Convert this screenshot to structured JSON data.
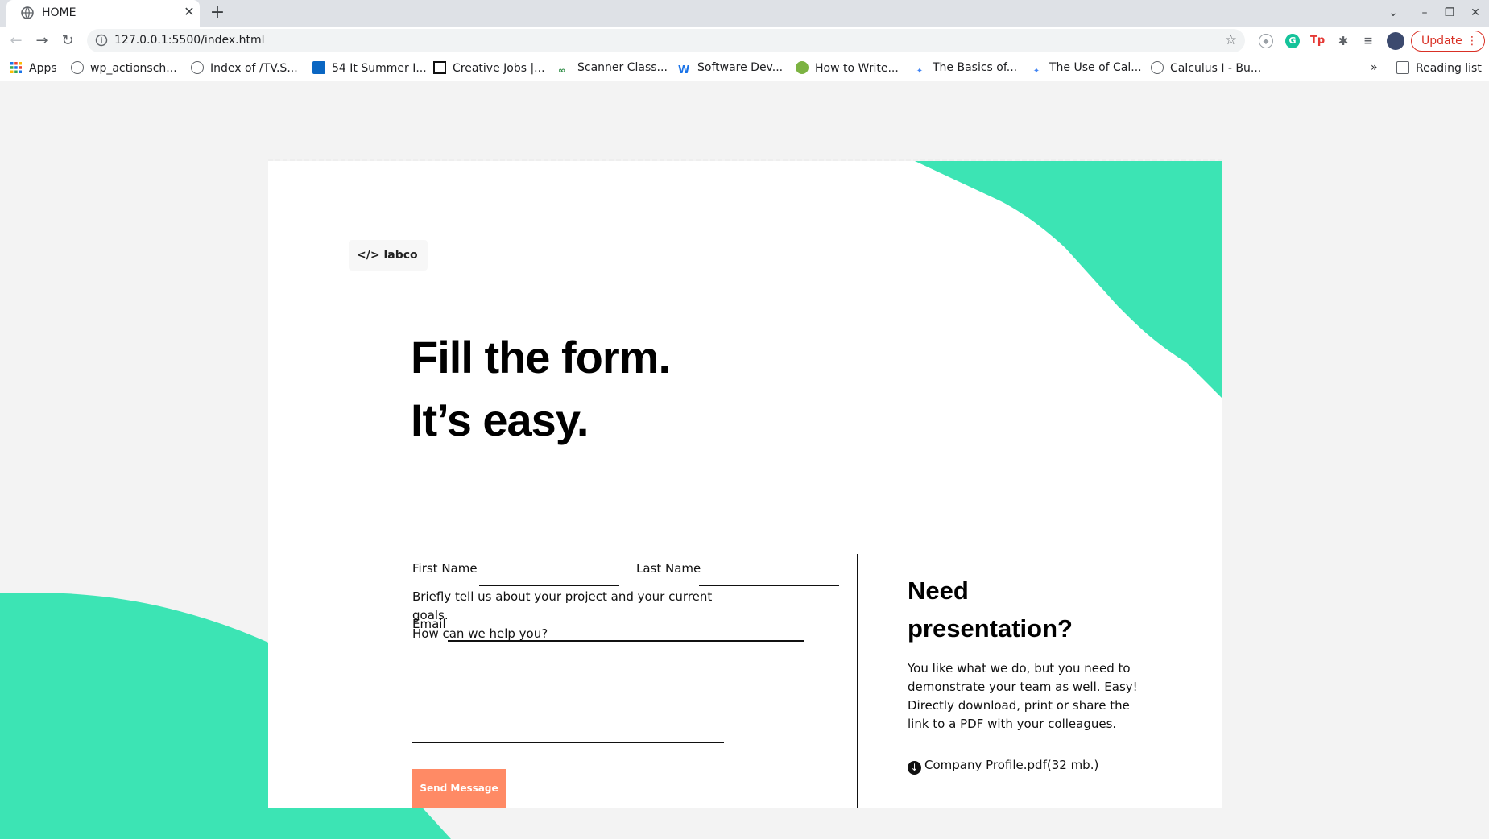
{
  "browser": {
    "tab_title": "HOME",
    "url": "127.0.0.1:5500/index.html",
    "update_label": "Update",
    "bookmarks": [
      "Apps",
      "wp_actionsch...",
      "Index of /TV.S...",
      "54 It Summer I...",
      "Creative Jobs |...",
      "Scanner Class...",
      "Software Dev...",
      "How to Write...",
      "The Basics of...",
      "The Use of Cal...",
      "Calculus I - Bu..."
    ],
    "more_bookmarks": "»",
    "reading_list": "Reading list"
  },
  "page": {
    "logo": "</> labco",
    "heading_line1": "Fill the form.",
    "heading_line2": "It’s easy.",
    "form": {
      "first_name_label": "First Name",
      "last_name_label": "Last Name",
      "email_label": "Email",
      "message_label_line1": "Briefly tell us about your project and your current goals.",
      "message_label_line2": "How can we help you?",
      "send_label": "Send Message"
    },
    "side": {
      "title_line1": "Need",
      "title_line2": "presentation?",
      "text": "You like what we do, but you need to demonstrate your team as well. Easy! Directly download, print or share the link to a PDF with your colleagues.",
      "pdf_label": "Company Profile.pdf(32 mb.)"
    }
  },
  "colors": {
    "accent_green": "#3ce4b4",
    "button_coral": "#ff8a65",
    "page_bg": "#f3f3f3"
  }
}
